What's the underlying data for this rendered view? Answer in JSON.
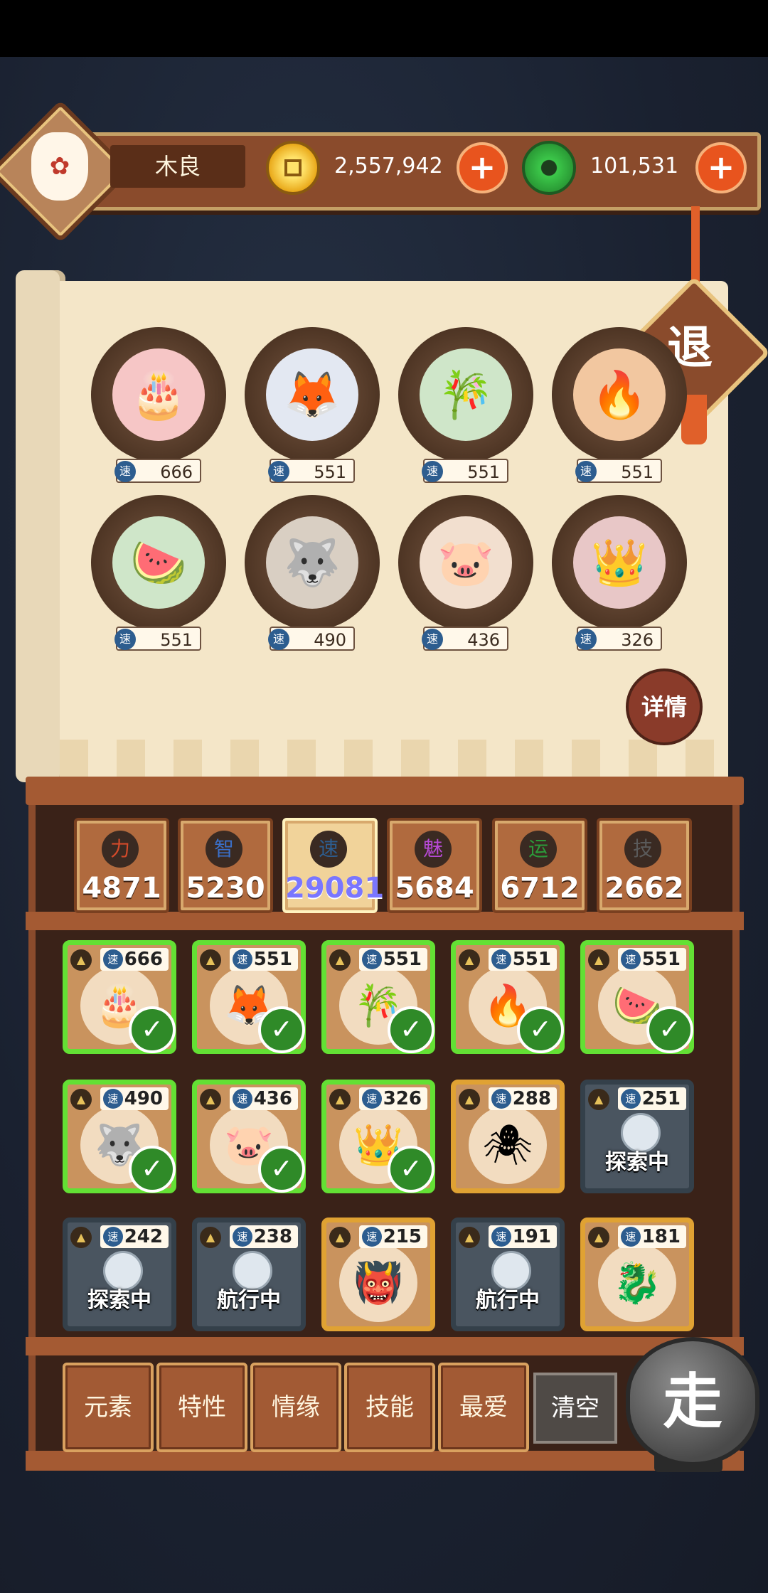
{
  "player": {
    "name": "木良",
    "gold": "2,557,942",
    "jade": "101,531"
  },
  "exit_label": "退",
  "detail_label": "详情",
  "speed_icon": "速",
  "team": [
    {
      "speed": "666",
      "emoji": "🎂",
      "bg": "#f6c6c6"
    },
    {
      "speed": "551",
      "emoji": "🦊",
      "bg": "#e3e8f2"
    },
    {
      "speed": "551",
      "emoji": "🎋",
      "bg": "#cfe6c9"
    },
    {
      "speed": "551",
      "emoji": "🔥",
      "bg": "#f2c7a0"
    },
    {
      "speed": "551",
      "emoji": "🍉",
      "bg": "#cfe6c9"
    },
    {
      "speed": "490",
      "emoji": "🐺",
      "bg": "#d9cfc3"
    },
    {
      "speed": "436",
      "emoji": "🐷",
      "bg": "#f2dfcf"
    },
    {
      "speed": "326",
      "emoji": "👑",
      "bg": "#e8c7c7"
    }
  ],
  "stats": [
    {
      "label": "力",
      "value": "4871",
      "color": "#d24a2a"
    },
    {
      "label": "智",
      "value": "5230",
      "color": "#3a6fc8"
    },
    {
      "label": "速",
      "value": "29081",
      "color": "#2d5d8f"
    },
    {
      "label": "魅",
      "value": "5684",
      "color": "#b84ad8"
    },
    {
      "label": "运",
      "value": "6712",
      "color": "#2c9a3a"
    },
    {
      "label": "技",
      "value": "2662",
      "color": "#5a5a5a"
    }
  ],
  "roster": [
    {
      "speed": "666",
      "emoji": "🎂",
      "state": "selected",
      "status": ""
    },
    {
      "speed": "551",
      "emoji": "🦊",
      "state": "selected",
      "status": ""
    },
    {
      "speed": "551",
      "emoji": "🎋",
      "state": "selected",
      "status": ""
    },
    {
      "speed": "551",
      "emoji": "🔥",
      "state": "selected",
      "status": ""
    },
    {
      "speed": "551",
      "emoji": "🍉",
      "state": "selected",
      "status": ""
    },
    {
      "speed": "490",
      "emoji": "🐺",
      "state": "selected",
      "status": ""
    },
    {
      "speed": "436",
      "emoji": "🐷",
      "state": "selected",
      "status": ""
    },
    {
      "speed": "326",
      "emoji": "👑",
      "state": "selected",
      "status": ""
    },
    {
      "speed": "288",
      "emoji": "🕷",
      "state": "available",
      "status": ""
    },
    {
      "speed": "251",
      "emoji": "",
      "state": "busy",
      "status": "探索中"
    },
    {
      "speed": "242",
      "emoji": "",
      "state": "busy",
      "status": "探索中"
    },
    {
      "speed": "238",
      "emoji": "",
      "state": "busy",
      "status": "航行中"
    },
    {
      "speed": "215",
      "emoji": "👹",
      "state": "available",
      "status": ""
    },
    {
      "speed": "191",
      "emoji": "",
      "state": "busy",
      "status": "航行中"
    },
    {
      "speed": "181",
      "emoji": "🐉",
      "state": "available",
      "status": ""
    }
  ],
  "filters": [
    "元素",
    "特性",
    "情缘",
    "技能",
    "最爱"
  ],
  "clear_label": "清空",
  "go_label": "走"
}
